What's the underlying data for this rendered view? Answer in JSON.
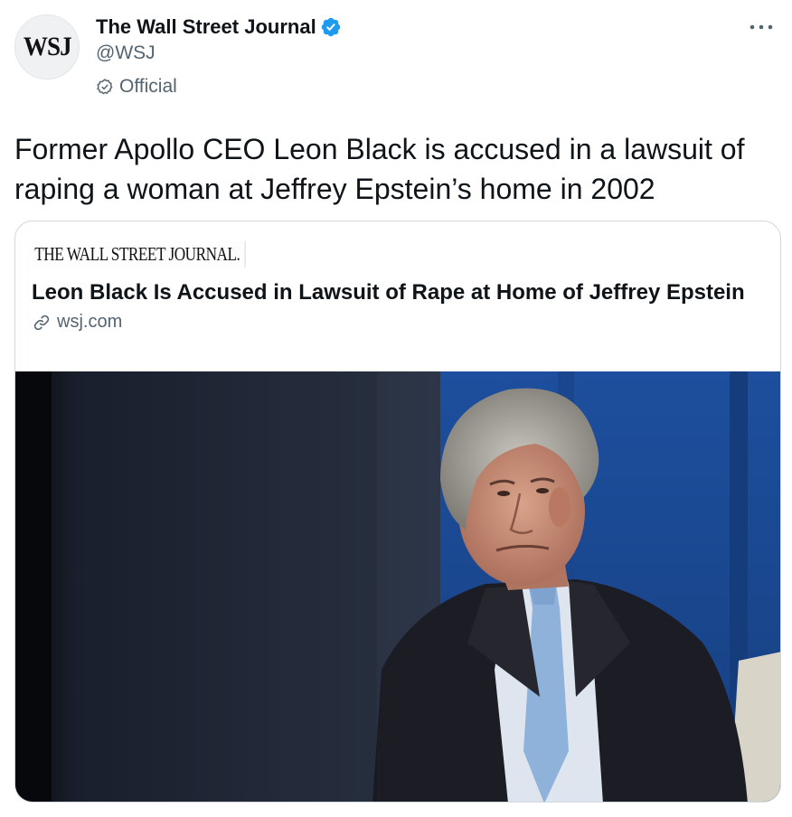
{
  "account": {
    "avatar_text": "WSJ",
    "name": "The Wall Street Journal",
    "handle": "@WSJ",
    "label": "Official"
  },
  "tweet": {
    "text": "Former Apollo CEO Leon Black is accused in a lawsuit of raping a woman at Jeffrey Epstein’s home in 2002"
  },
  "card": {
    "publisher": "THE WALL STREET JOURNAL.",
    "headline": "Leon Black Is Accused in Lawsuit of Rape at Home of Jeffrey Epstein",
    "domain": "wsj.com"
  },
  "icons": {
    "verified": "verified-badge-icon",
    "official": "official-label-icon",
    "more": "more-options-icon",
    "link": "link-icon"
  },
  "colors": {
    "verified_blue": "#1d9bf0",
    "secondary_text": "#536471",
    "primary_text": "#0f1419",
    "border": "#cfd9de"
  }
}
